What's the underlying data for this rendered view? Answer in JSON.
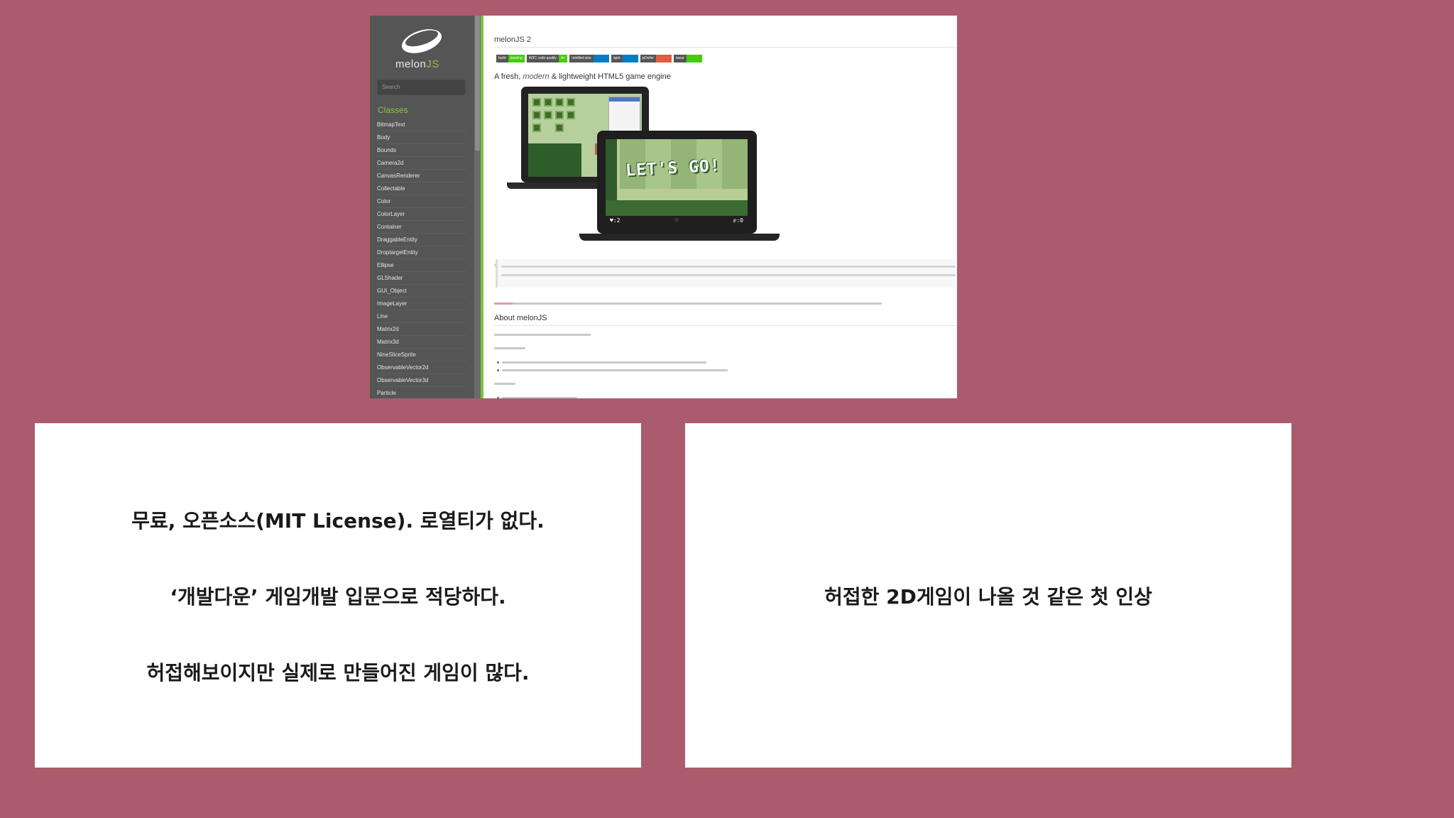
{
  "docs": {
    "logo_text": "melon",
    "logo_text_js": "JS",
    "search_placeholder": "Search",
    "classes_heading": "Classes",
    "classes": [
      "BitmapText",
      "Body",
      "Bounds",
      "Camera2d",
      "CanvasRenderer",
      "Collectable",
      "Color",
      "ColorLayer",
      "Container",
      "DraggableEntity",
      "DroptargetEntity",
      "Ellipse",
      "GLShader",
      "GUI_Object",
      "ImageLayer",
      "Line",
      "Matrix2d",
      "Matrix3d",
      "NineSliceSprite",
      "ObservableVector2d",
      "ObservableVector3d",
      "Particle"
    ],
    "title": "melonJS 2",
    "badges": [
      {
        "left": "build",
        "right": "passing",
        "color": "#4c1"
      },
      {
        "left": "W3C code quality",
        "right": "A+",
        "color": "#4c1"
      },
      {
        "left": "minified size",
        "right": "",
        "color": "#007ec6"
      },
      {
        "left": "npm",
        "right": "",
        "color": "#007ec6"
      },
      {
        "left": "jsDelivr",
        "right": "",
        "color": "#e05d44"
      },
      {
        "left": "issue",
        "right": "",
        "color": "#4c1"
      }
    ],
    "tagline_pre": "A fresh, ",
    "tagline_em": "modern",
    "tagline_post": " & lightweight HTML5 game engine",
    "game_text": "LET'S GO!",
    "hud_left": "♥:2",
    "hud_mid": "♡",
    "hud_right": "ⅇ:0",
    "about_heading": "About melonJS"
  },
  "panels": {
    "left_lines": [
      "무료, 오픈소스(MIT License). 로열티가 없다.",
      "‘개발다운’ 게임개발 입문으로 적당하다.",
      "허접해보이지만 실제로 만들어진 게임이 많다."
    ],
    "right_line": "허접한 2D게임이 나올 것 같은 첫 인상"
  }
}
